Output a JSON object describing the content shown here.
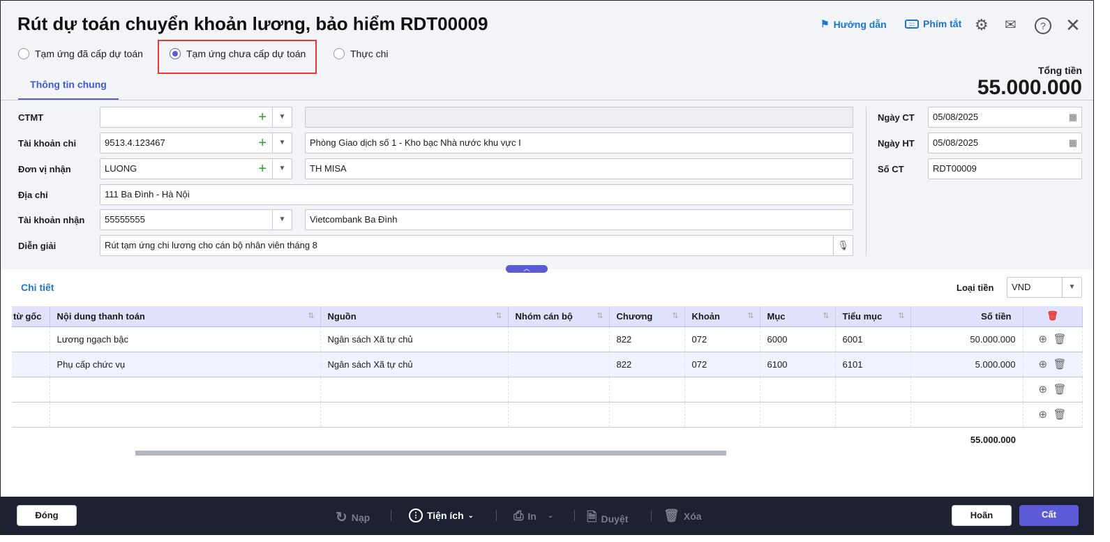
{
  "title": "Rút dự toán chuyển khoản lương, bảo hiểm RDT00009",
  "toolbar": {
    "guide": "Hướng dẫn",
    "shortcuts": "Phím tắt"
  },
  "radios": [
    {
      "label": "Tạm ứng đã cấp dự toán",
      "checked": false
    },
    {
      "label": "Tạm ứng chưa cấp dự toán",
      "checked": true
    },
    {
      "label": "Thực chi",
      "checked": false
    }
  ],
  "tab": "Thông tin chung",
  "total": {
    "label": "Tổng tiền",
    "value": "55.000.000"
  },
  "form": {
    "ctmt": {
      "label": "CTMT",
      "value": "",
      "desc": ""
    },
    "tk_chi": {
      "label": "Tài khoản chi",
      "value": "9513.4.123467",
      "desc": "Phòng Giao dịch số 1 - Kho bạc Nhà nước khu vực I"
    },
    "don_vi": {
      "label": "Đơn vị nhận",
      "value": "LUONG",
      "desc": "TH MISA"
    },
    "dia_chi": {
      "label": "Địa chỉ",
      "value": "111 Ba Đình - Hà Nội"
    },
    "tk_nhan": {
      "label": "Tài khoản nhận",
      "value": "55555555",
      "desc": "Vietcombank Ba Đình"
    },
    "dien_giai": {
      "label": "Diễn giải",
      "value": "Rút tạm ứng chi lương cho cán bộ nhân viên tháng 8"
    },
    "ngay_ct": {
      "label": "Ngày CT",
      "value": "05/08/2025"
    },
    "ngay_ht": {
      "label": "Ngày HT",
      "value": "05/08/2025"
    },
    "so_ct": {
      "label": "Số CT",
      "value": "RDT00009"
    }
  },
  "detail": {
    "title": "Chi tiết",
    "currency_label": "Loại tiền",
    "currency": "VND"
  },
  "table": {
    "headers": [
      "từ gốc",
      "Nội dung thanh toán",
      "Nguồn",
      "Nhóm cán bộ",
      "Chương",
      "Khoản",
      "Mục",
      "Tiểu mục",
      "Số tiền"
    ],
    "rows": [
      [
        "",
        "Lương ngạch bậc",
        "Ngân sách Xã tự chủ",
        "",
        "822",
        "072",
        "6000",
        "6001",
        "50.000.000"
      ],
      [
        "",
        "Phụ cấp chức vụ",
        "Ngân sách Xã tự chủ",
        "",
        "822",
        "072",
        "6100",
        "6101",
        "5.000.000"
      ]
    ],
    "total": "55.000.000"
  },
  "footer": {
    "close": "Đóng",
    "reload": "Nạp",
    "utilities": "Tiện ích",
    "print": "In",
    "approve": "Duyệt",
    "delete": "Xóa",
    "cancel": "Hoãn",
    "save": "Cất"
  }
}
